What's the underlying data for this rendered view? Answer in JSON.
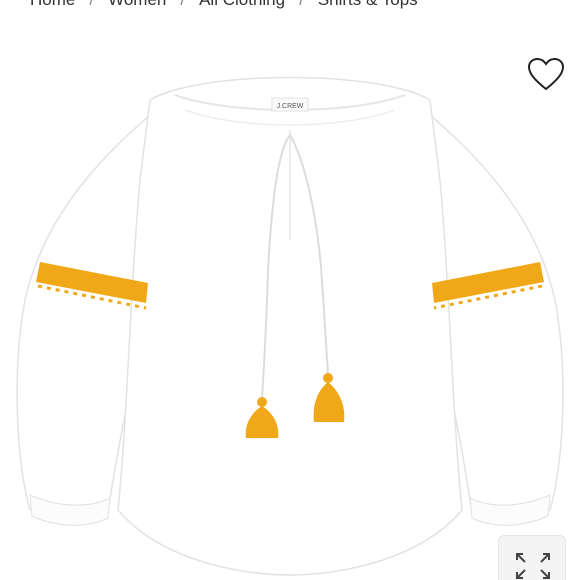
{
  "breadcrumb": {
    "items": [
      "Home",
      "Women",
      "All Clothing",
      "Shirts & Tops"
    ],
    "separator": "/"
  },
  "product_image": {
    "alt": "white peasant top with yellow tassels",
    "label_text": "J.CREW"
  },
  "icons": {
    "favorite": "heart-outline-icon",
    "expand": "expand-arrows-icon"
  },
  "colors": {
    "garment": "#ffffff",
    "accent_yellow": "#f0a818",
    "outline": "#e3e3e3"
  }
}
